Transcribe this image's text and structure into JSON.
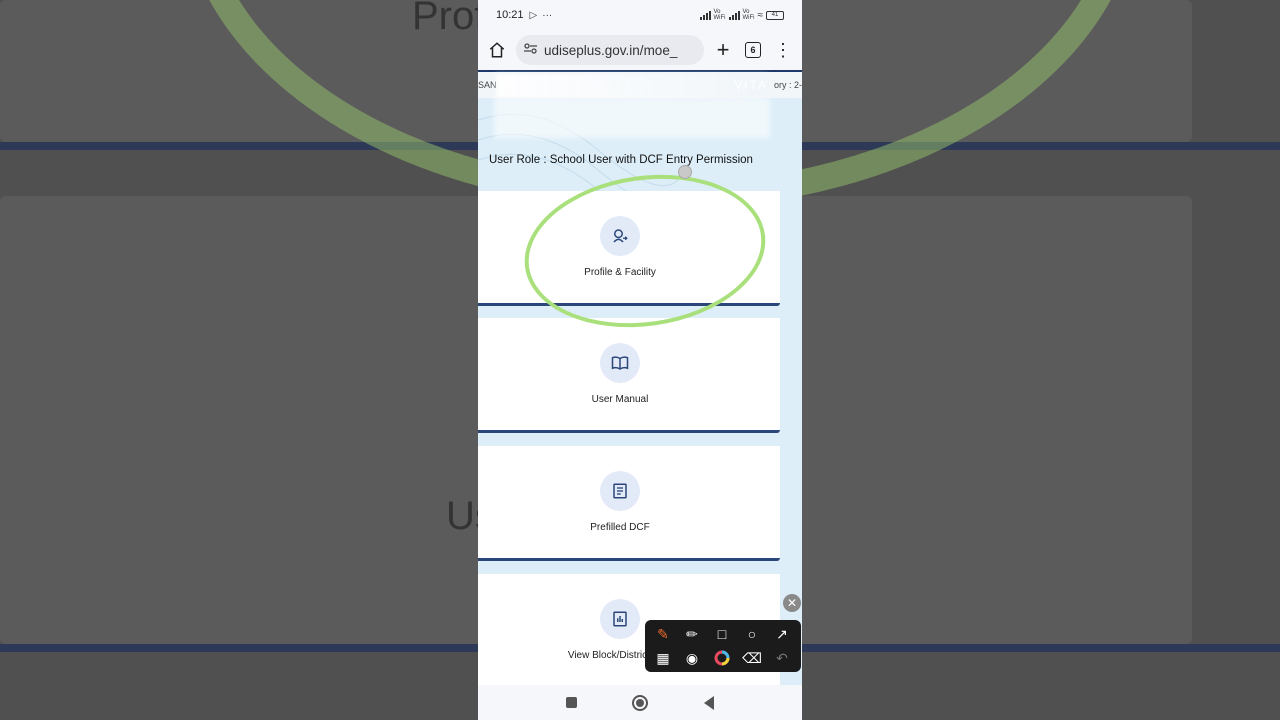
{
  "status_bar": {
    "time": "10:21",
    "battery": "41",
    "wifi_label_1": "Vo WiFi",
    "wifi_label_2": "Vo WiFi"
  },
  "browser": {
    "url": "udiseplus.gov.in/moe_",
    "tab_count": "6"
  },
  "page": {
    "top_strip_left": "SAN",
    "top_strip_right": "ory : 2-",
    "watermark": "VITA",
    "user_role": "User Role : School User with DCF Entry Permission",
    "cards": [
      {
        "label": "Profile & Facility",
        "icon": "profile-facility-icon"
      },
      {
        "label": "User Manual",
        "icon": "book-icon"
      },
      {
        "label": "Prefilled DCF",
        "icon": "document-icon"
      },
      {
        "label": "View Block/District Mon",
        "icon": "chart-report-icon"
      }
    ]
  },
  "background": {
    "text_top": "Prof",
    "text_middle": "Us"
  },
  "annotation_toolbar": {
    "tools": [
      "pen-icon",
      "marker-icon",
      "rectangle-icon",
      "circle-icon",
      "arrow-icon",
      "mosaic-icon",
      "camera-icon",
      "color-wheel-icon",
      "eraser-icon",
      "undo-icon"
    ],
    "accent": "#f26b2a",
    "circle_color": "#a9e07c"
  }
}
